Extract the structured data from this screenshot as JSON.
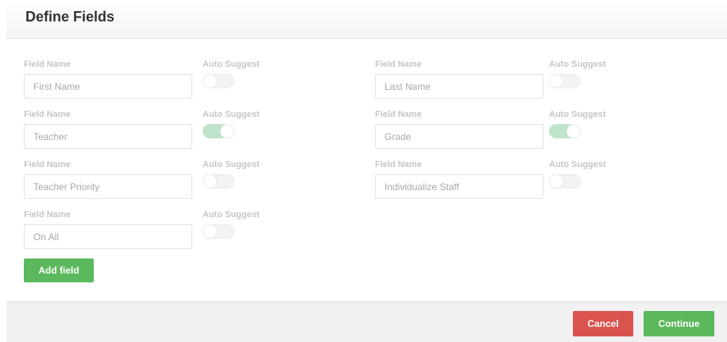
{
  "header": {
    "title": "Define Fields"
  },
  "fields": [
    {
      "label": "Field Name",
      "value": "First Name",
      "auto_label": "Auto Suggest",
      "auto_suggest": false
    },
    {
      "label": "Field Name",
      "value": "Last Name",
      "auto_label": "Auto Suggest",
      "auto_suggest": false
    },
    {
      "label": "Field Name",
      "value": "Teacher",
      "auto_label": "Auto Suggest",
      "auto_suggest": true
    },
    {
      "label": "Field Name",
      "value": "Grade",
      "auto_label": "Auto Suggest",
      "auto_suggest": true
    },
    {
      "label": "Field Name",
      "value": "Teacher Priority",
      "auto_label": "Auto Suggest",
      "auto_suggest": false
    },
    {
      "label": "Field Name",
      "value": "Individualize Staff",
      "auto_label": "Auto Suggest",
      "auto_suggest": false
    },
    {
      "label": "Field Name",
      "value": "On All",
      "auto_label": "Auto Suggest",
      "auto_suggest": false
    }
  ],
  "actions": {
    "add_field_label": "Add field",
    "cancel_label": "Cancel",
    "continue_label": "Continue"
  },
  "colors": {
    "success": "#5cb85c",
    "danger": "#d9534f",
    "toggle_on": "#bfe3cb",
    "label": "#c6c6c6"
  }
}
